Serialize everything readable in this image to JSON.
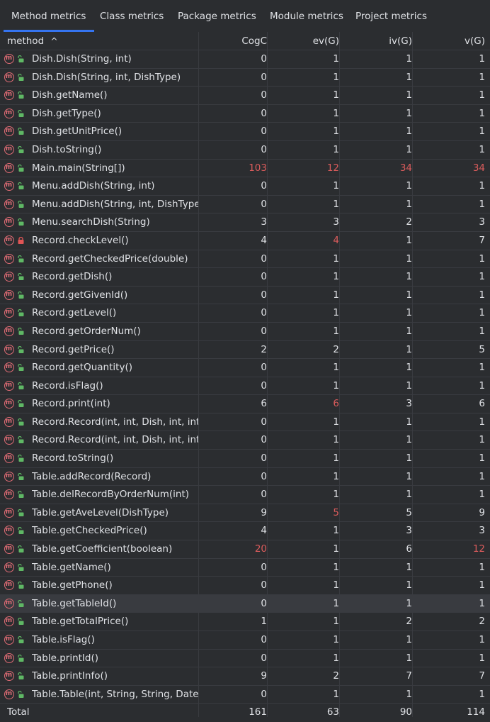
{
  "tabs": [
    {
      "label": "Method metrics",
      "active": true
    },
    {
      "label": "Class metrics",
      "active": false
    },
    {
      "label": "Package metrics",
      "active": false
    },
    {
      "label": "Module metrics",
      "active": false
    },
    {
      "label": "Project metrics",
      "active": false
    }
  ],
  "columns": {
    "method": "method",
    "sort": "^",
    "cogc": "CogC",
    "evg": "ev(G)",
    "ivg": "iv(G)",
    "vg": "v(G)"
  },
  "colors": {
    "highlight": "#db5c5c",
    "accent": "#3574f0",
    "public_icon": "#5fb865",
    "private_icon": "#e05555"
  },
  "rows": [
    {
      "name": "Dish.Dish(String, int)",
      "cogc": "0",
      "evg": "1",
      "ivg": "1",
      "vg": "1",
      "vis": "public"
    },
    {
      "name": "Dish.Dish(String, int, DishType)",
      "cogc": "0",
      "evg": "1",
      "ivg": "1",
      "vg": "1",
      "vis": "public"
    },
    {
      "name": "Dish.getName()",
      "cogc": "0",
      "evg": "1",
      "ivg": "1",
      "vg": "1",
      "vis": "public"
    },
    {
      "name": "Dish.getType()",
      "cogc": "0",
      "evg": "1",
      "ivg": "1",
      "vg": "1",
      "vis": "public"
    },
    {
      "name": "Dish.getUnitPrice()",
      "cogc": "0",
      "evg": "1",
      "ivg": "1",
      "vg": "1",
      "vis": "public"
    },
    {
      "name": "Dish.toString()",
      "cogc": "0",
      "evg": "1",
      "ivg": "1",
      "vg": "1",
      "vis": "public"
    },
    {
      "name": "Main.main(String[])",
      "cogc": "103",
      "evg": "12",
      "ivg": "34",
      "vg": "34",
      "vis": "public",
      "red": [
        "cogc",
        "evg",
        "ivg",
        "vg"
      ]
    },
    {
      "name": "Menu.addDish(String, int)",
      "cogc": "0",
      "evg": "1",
      "ivg": "1",
      "vg": "1",
      "vis": "public"
    },
    {
      "name": "Menu.addDish(String, int, DishType)",
      "cogc": "0",
      "evg": "1",
      "ivg": "1",
      "vg": "1",
      "vis": "public"
    },
    {
      "name": "Menu.searchDish(String)",
      "cogc": "3",
      "evg": "3",
      "ivg": "2",
      "vg": "3",
      "vis": "public"
    },
    {
      "name": "Record.checkLevel()",
      "cogc": "4",
      "evg": "4",
      "ivg": "1",
      "vg": "7",
      "vis": "private",
      "red": [
        "evg"
      ]
    },
    {
      "name": "Record.getCheckedPrice(double)",
      "cogc": "0",
      "evg": "1",
      "ivg": "1",
      "vg": "1",
      "vis": "public"
    },
    {
      "name": "Record.getDish()",
      "cogc": "0",
      "evg": "1",
      "ivg": "1",
      "vg": "1",
      "vis": "public"
    },
    {
      "name": "Record.getGivenId()",
      "cogc": "0",
      "evg": "1",
      "ivg": "1",
      "vg": "1",
      "vis": "public"
    },
    {
      "name": "Record.getLevel()",
      "cogc": "0",
      "evg": "1",
      "ivg": "1",
      "vg": "1",
      "vis": "public"
    },
    {
      "name": "Record.getOrderNum()",
      "cogc": "0",
      "evg": "1",
      "ivg": "1",
      "vg": "1",
      "vis": "public"
    },
    {
      "name": "Record.getPrice()",
      "cogc": "2",
      "evg": "2",
      "ivg": "1",
      "vg": "5",
      "vis": "public"
    },
    {
      "name": "Record.getQuantity()",
      "cogc": "0",
      "evg": "1",
      "ivg": "1",
      "vg": "1",
      "vis": "public"
    },
    {
      "name": "Record.isFlag()",
      "cogc": "0",
      "evg": "1",
      "ivg": "1",
      "vg": "1",
      "vis": "public"
    },
    {
      "name": "Record.print(int)",
      "cogc": "6",
      "evg": "6",
      "ivg": "3",
      "vg": "6",
      "vis": "public",
      "red": [
        "evg"
      ]
    },
    {
      "name": "Record.Record(int, int, Dish, int, int)",
      "cogc": "0",
      "evg": "1",
      "ivg": "1",
      "vg": "1",
      "vis": "public"
    },
    {
      "name": "Record.Record(int, int, Dish, int, int, i",
      "cogc": "0",
      "evg": "1",
      "ivg": "1",
      "vg": "1",
      "vis": "public"
    },
    {
      "name": "Record.toString()",
      "cogc": "0",
      "evg": "1",
      "ivg": "1",
      "vg": "1",
      "vis": "public"
    },
    {
      "name": "Table.addRecord(Record)",
      "cogc": "0",
      "evg": "1",
      "ivg": "1",
      "vg": "1",
      "vis": "public"
    },
    {
      "name": "Table.delRecordByOrderNum(int)",
      "cogc": "0",
      "evg": "1",
      "ivg": "1",
      "vg": "1",
      "vis": "public"
    },
    {
      "name": "Table.getAveLevel(DishType)",
      "cogc": "9",
      "evg": "5",
      "ivg": "5",
      "vg": "9",
      "vis": "public",
      "red": [
        "evg"
      ]
    },
    {
      "name": "Table.getCheckedPrice()",
      "cogc": "4",
      "evg": "1",
      "ivg": "3",
      "vg": "3",
      "vis": "public"
    },
    {
      "name": "Table.getCoefficient(boolean)",
      "cogc": "20",
      "evg": "1",
      "ivg": "6",
      "vg": "12",
      "vis": "public",
      "red": [
        "cogc",
        "vg"
      ]
    },
    {
      "name": "Table.getName()",
      "cogc": "0",
      "evg": "1",
      "ivg": "1",
      "vg": "1",
      "vis": "public"
    },
    {
      "name": "Table.getPhone()",
      "cogc": "0",
      "evg": "1",
      "ivg": "1",
      "vg": "1",
      "vis": "public"
    },
    {
      "name": "Table.getTableId()",
      "cogc": "0",
      "evg": "1",
      "ivg": "1",
      "vg": "1",
      "vis": "public",
      "selected": true
    },
    {
      "name": "Table.getTotalPrice()",
      "cogc": "1",
      "evg": "1",
      "ivg": "2",
      "vg": "2",
      "vis": "public"
    },
    {
      "name": "Table.isFlag()",
      "cogc": "0",
      "evg": "1",
      "ivg": "1",
      "vg": "1",
      "vis": "public"
    },
    {
      "name": "Table.printId()",
      "cogc": "0",
      "evg": "1",
      "ivg": "1",
      "vg": "1",
      "vis": "public"
    },
    {
      "name": "Table.printInfo()",
      "cogc": "9",
      "evg": "2",
      "ivg": "7",
      "vg": "7",
      "vis": "public"
    },
    {
      "name": "Table.Table(int, String, String, Date, I",
      "cogc": "0",
      "evg": "1",
      "ivg": "1",
      "vg": "1",
      "vis": "public"
    }
  ],
  "total": {
    "label": "Total",
    "cogc": "161",
    "evg": "63",
    "ivg": "90",
    "vg": "114"
  }
}
